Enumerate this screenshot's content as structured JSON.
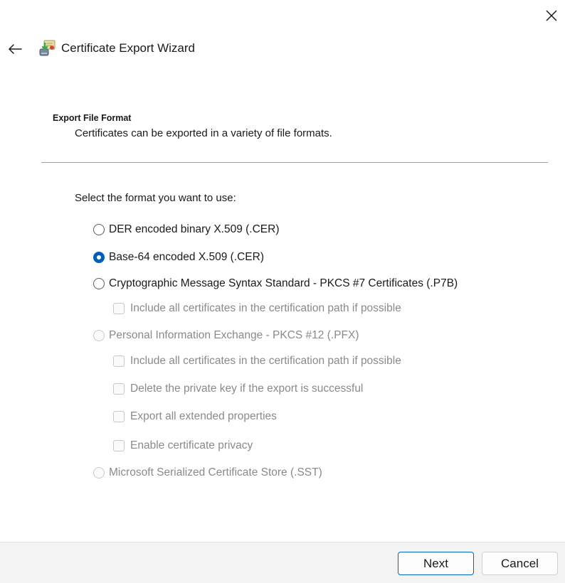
{
  "window": {
    "title": "Certificate Export Wizard",
    "icons": {
      "close": "close-icon",
      "back": "back-arrow-icon",
      "app": "certificate-export-icon"
    }
  },
  "section": {
    "heading": "Export File Format",
    "description": "Certificates can be exported in a variety of file formats."
  },
  "prompt": "Select the format you want to use:",
  "options": {
    "der": {
      "label": "DER encoded binary X.509 (.CER)",
      "checked": false,
      "enabled": true
    },
    "base64": {
      "label": "Base-64 encoded X.509 (.CER)",
      "checked": true,
      "enabled": true
    },
    "pkcs7": {
      "label": "Cryptographic Message Syntax Standard - PKCS #7 Certificates (.P7B)",
      "checked": false,
      "enabled": true
    },
    "pkcs7_include_all": {
      "label": "Include all certificates in the certification path if possible",
      "checked": false,
      "enabled": false
    },
    "pfx": {
      "label": "Personal Information Exchange - PKCS #12 (.PFX)",
      "checked": false,
      "enabled": false
    },
    "pfx_include_all": {
      "label": "Include all certificates in the certification path if possible",
      "checked": false,
      "enabled": false
    },
    "pfx_delete_key": {
      "label": "Delete the private key if the export is successful",
      "checked": false,
      "enabled": false
    },
    "pfx_export_ext": {
      "label": "Export all extended properties",
      "checked": false,
      "enabled": false
    },
    "pfx_privacy": {
      "label": "Enable certificate privacy",
      "checked": false,
      "enabled": false
    },
    "sst": {
      "label": "Microsoft Serialized Certificate Store (.SST)",
      "checked": false,
      "enabled": false
    }
  },
  "footer": {
    "next_label": "Next",
    "cancel_label": "Cancel"
  },
  "colors": {
    "accent": "#005fb8",
    "disabled_text": "#8a8a8a",
    "footer_bg": "#f3f3f3"
  }
}
